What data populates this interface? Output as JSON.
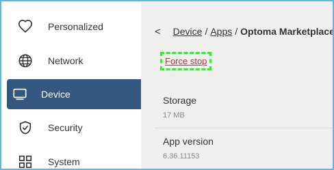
{
  "sidebar": {
    "items": [
      {
        "label": "Personalized",
        "icon": "heart-icon"
      },
      {
        "label": "Network",
        "icon": "globe-icon"
      },
      {
        "label": "Device",
        "icon": "monitor-icon",
        "active": true
      },
      {
        "label": "Security",
        "icon": "shield-check-icon"
      },
      {
        "label": "System",
        "icon": "grid-icon"
      }
    ]
  },
  "breadcrumb": {
    "back": "<",
    "items": [
      "Device",
      "Apps",
      "Optoma Marketplace"
    ],
    "separator": "/"
  },
  "force_stop": "Force stop",
  "storage": {
    "label": "Storage",
    "value": "17 MB"
  },
  "app_version": {
    "label": "App version",
    "value": "6.36.11153"
  },
  "colors": {
    "accent": "#34577f",
    "force_stop_text": "#c22f3a",
    "highlight_border": "#3ee63a",
    "frame_border": "#5bb7e6"
  }
}
